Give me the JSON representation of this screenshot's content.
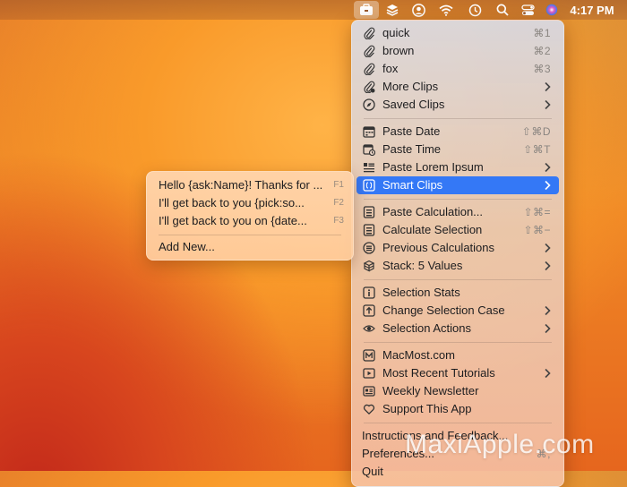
{
  "menubar": {
    "icons": [
      "clipboard-briefcase-icon",
      "layers-icon",
      "user-circle-icon",
      "wifi-icon",
      "time-machine-icon",
      "search-icon",
      "control-center-icon",
      "siri-icon"
    ],
    "clock": "4:17 PM"
  },
  "menu": {
    "items": [
      {
        "label": "quick",
        "shortcut": "⌘1",
        "icon": "paperclip-icon"
      },
      {
        "label": "brown",
        "shortcut": "⌘2",
        "icon": "paperclip-icon"
      },
      {
        "label": "fox",
        "shortcut": "⌘3",
        "icon": "paperclip-icon"
      },
      {
        "label": "More Clips",
        "icon": "paperclip-dot-icon",
        "submenu": true
      },
      {
        "label": "Saved Clips",
        "icon": "compass-icon",
        "submenu": true
      },
      {
        "label": "Paste Date",
        "shortcut": "⇧⌘D",
        "icon": "calendar-icon"
      },
      {
        "label": "Paste Time",
        "shortcut": "⇧⌘T",
        "icon": "calendar-clock-icon"
      },
      {
        "label": "Paste Lorem Ipsum",
        "icon": "text-lines-icon",
        "submenu": true
      },
      {
        "label": "Smart Clips",
        "icon": "braces-icon",
        "submenu": true,
        "highlighted": true
      },
      {
        "label": "Paste Calculation...",
        "shortcut": "⇧⌘=",
        "icon": "calculator-icon"
      },
      {
        "label": "Calculate Selection",
        "shortcut": "⇧⌘−",
        "icon": "calculator-icon"
      },
      {
        "label": "Previous Calculations",
        "icon": "list-circle-icon",
        "submenu": true
      },
      {
        "label": "Stack: 5 Values",
        "icon": "stack-icon",
        "submenu": true
      },
      {
        "label": "Selection Stats",
        "icon": "info-icon"
      },
      {
        "label": "Change Selection Case",
        "icon": "arrow-up-square-icon",
        "submenu": true
      },
      {
        "label": "Selection Actions",
        "icon": "eye-gear-icon",
        "submenu": true
      },
      {
        "label": "MacMost.com",
        "icon": "macmost-logo-icon"
      },
      {
        "label": "Most Recent Tutorials",
        "icon": "play-icon",
        "submenu": true
      },
      {
        "label": "Weekly Newsletter",
        "icon": "newsletter-icon"
      },
      {
        "label": "Support This App",
        "icon": "heart-icon"
      },
      {
        "label": "Instructions and Feedback..."
      },
      {
        "label": "Preferences...",
        "shortcut": "⌘,"
      },
      {
        "label": "Quit"
      }
    ]
  },
  "submenu": {
    "items": [
      {
        "label": "Hello {ask:Name}! Thanks for ...",
        "key": "F1"
      },
      {
        "label": "I'll get back to you {pick:so...",
        "key": "F2"
      },
      {
        "label": "I'll get back to you on {date...",
        "key": "F3"
      },
      {
        "label": "Add New..."
      }
    ]
  },
  "watermark": "MaxiApple.com"
}
